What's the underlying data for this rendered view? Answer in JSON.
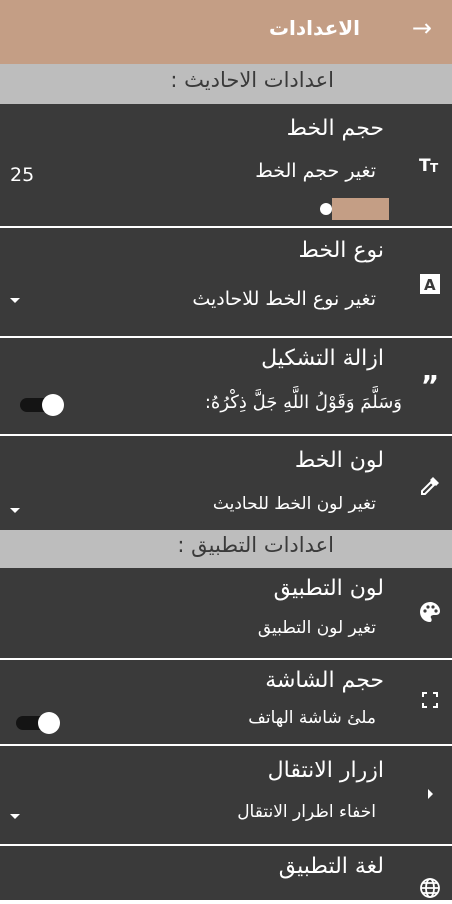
{
  "header": {
    "title": "الاعدادات",
    "back_icon": "arrow-right-icon",
    "bar_color": "#c49e85"
  },
  "sections": {
    "hadith": "اعدادات الاحاديث :",
    "app": "اعدادات التطبيق :"
  },
  "settings": {
    "font_size": {
      "title": "حجم الخط",
      "subtitle": "تغير حجم الخط",
      "value": "25",
      "icon": "text-size-icon"
    },
    "font_type": {
      "title": "نوع الخط",
      "subtitle": "تغير نوع الخط للاحاديث",
      "icon": "font-icon"
    },
    "remove_diacritics": {
      "title": "ازالة التشكيل",
      "subtitle": "وَسَلَّمَ وَقَوْلُ اللَّهِ جَلَّ ذِكْرُهُ:",
      "icon": "quote-icon",
      "enabled": true
    },
    "font_color": {
      "title": "لون الخط",
      "subtitle": "تغير لون الخط للحاديث",
      "icon": "eyedropper-icon"
    },
    "app_color": {
      "title": "لون التطبيق",
      "subtitle": "تغير لون التطبيق",
      "icon": "palette-icon"
    },
    "screen_size": {
      "title": "حجم الشاشة",
      "subtitle": "ملئ شاشة الهاتف",
      "icon": "fullscreen-icon",
      "enabled": true
    },
    "nav_buttons": {
      "title": "ازرار الانتقال",
      "subtitle": "اخفاء اظرار الانتقال",
      "icon": "chevron-right-icon"
    },
    "app_language": {
      "title": "لغة التطبيق",
      "icon": "globe-icon"
    }
  },
  "colors": {
    "accent": "#c49e85",
    "card": "#3a3a3a",
    "section": "#bdbdbd"
  }
}
